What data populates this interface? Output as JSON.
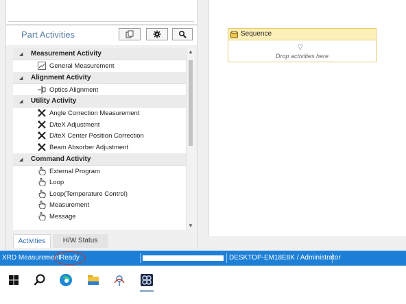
{
  "panel": {
    "title": "Part Activities",
    "buttons": [
      {
        "icon": "copy-icon"
      },
      {
        "icon": "gear-icon"
      },
      {
        "icon": "search-icon"
      }
    ]
  },
  "tree": {
    "categories": [
      {
        "label": "Measurement Activity",
        "items": [
          {
            "label": "General Measurement",
            "icon": "chart-icon"
          }
        ]
      },
      {
        "label": "Alignment Activity",
        "items": [
          {
            "label": "Optics Alignment",
            "icon": "alignment-icon"
          }
        ]
      },
      {
        "label": "Utility Activity",
        "items": [
          {
            "label": "Angle Correction Measurement",
            "icon": "tools-icon"
          },
          {
            "label": "D/teX Adjustment",
            "icon": "tools-icon"
          },
          {
            "label": "D/teX Center Position Correction",
            "icon": "tools-icon"
          },
          {
            "label": "Beam Absorber Adjustment",
            "icon": "tools-icon"
          }
        ]
      },
      {
        "label": "Command Activity",
        "items": [
          {
            "label": "External Program",
            "icon": "hand-pointer-icon"
          },
          {
            "label": "Loop",
            "icon": "hand-pointer-icon"
          },
          {
            "label": "Loop(Temperature Control)",
            "icon": "hand-pointer-icon"
          },
          {
            "label": "Measurement",
            "icon": "hand-pointer-icon"
          },
          {
            "label": "Message",
            "icon": "hand-pointer-icon"
          }
        ]
      }
    ]
  },
  "tabs": [
    {
      "label": "Activities",
      "active": true
    },
    {
      "label": "H/W Status",
      "active": false
    }
  ],
  "designer": {
    "sequence_title": "Sequence",
    "drop_hint": "Drop activities here"
  },
  "status": {
    "app": "XRD Measurement",
    "state": "Ready",
    "user": "DESKTOP-EM18E8K / Administrator"
  },
  "colors": {
    "status_bar": "#1e7fd6",
    "panel_title": "#5b7fa6",
    "sequence_header": "#fdefb8",
    "annotation_circle": "#c0392b"
  },
  "taskbar": {
    "icons": [
      "windows-start-icon",
      "search-icon",
      "edge-browser-icon",
      "file-explorer-icon",
      "xrd-app-icon",
      "app-logo-icon"
    ]
  }
}
